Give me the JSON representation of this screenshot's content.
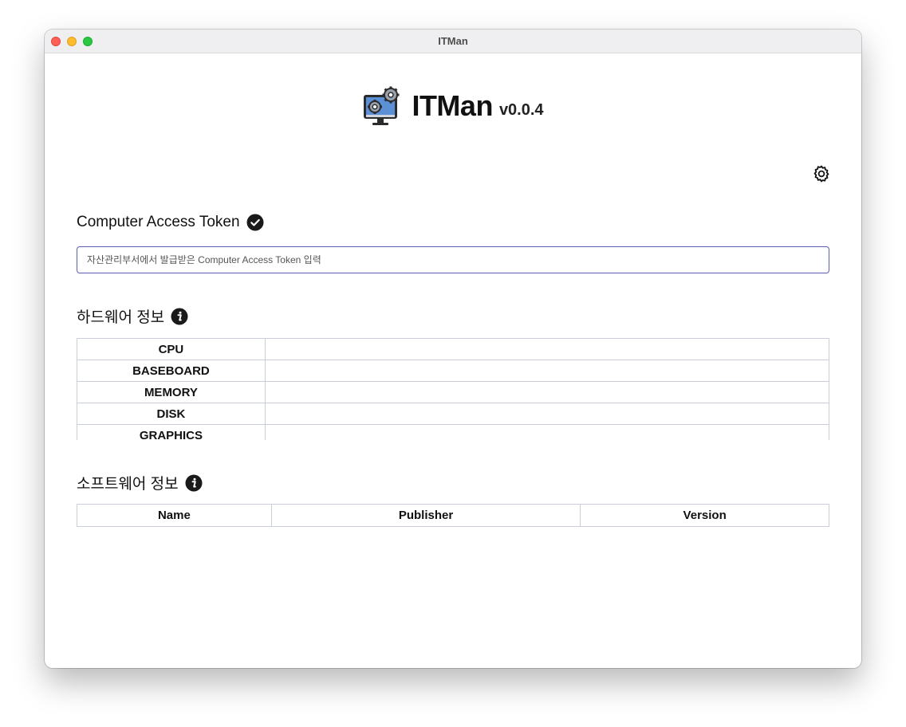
{
  "window": {
    "title": "ITMan"
  },
  "header": {
    "app_name": "ITMan",
    "version": "v0.0.4"
  },
  "token": {
    "title": "Computer Access Token",
    "placeholder": "자산관리부서에서 발급받은 Computer Access Token 입력",
    "value": ""
  },
  "hardware": {
    "title": "하드웨어 정보",
    "rows": [
      {
        "label": "CPU",
        "value": ""
      },
      {
        "label": "BASEBOARD",
        "value": ""
      },
      {
        "label": "MEMORY",
        "value": ""
      },
      {
        "label": "DISK",
        "value": ""
      },
      {
        "label": "GRAPHICS",
        "value": ""
      }
    ]
  },
  "software": {
    "title": "소프트웨어 정보",
    "columns": [
      "Name",
      "Publisher",
      "Version"
    ]
  },
  "colors": {
    "input_border": "#5a5fb5",
    "table_border": "#c9ced6",
    "logo_screen": "#5b8fd6",
    "traffic_close": "#fe5f57",
    "traffic_min": "#febc2e",
    "traffic_max": "#28c840"
  },
  "icons": {
    "logo": "computer-gears-icon",
    "settings": "gear-icon",
    "token_status": "check-circle-icon",
    "hardware_info": "info-circle-icon",
    "software_info": "info-circle-icon"
  }
}
